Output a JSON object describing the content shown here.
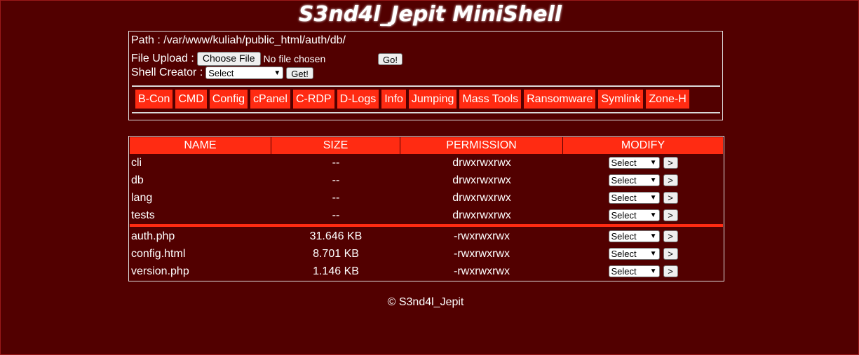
{
  "header": {
    "title": "S3nd4l_Jepit MiniShell"
  },
  "panel": {
    "path_label": "Path :",
    "path_value": "/var/www/kuliah/public_html/auth/db/",
    "upload_label": "File Upload :",
    "choose_file_label": "Choose File",
    "no_file_text": "No file chosen",
    "go_label": "Go!",
    "shell_label": "Shell Creator :",
    "shell_select": "Select",
    "get_label": "Get!",
    "tools": [
      "B-Con",
      "CMD",
      "Config",
      "cPanel",
      "C-RDP",
      "D-Logs",
      "Info",
      "Jumping",
      "Mass Tools",
      "Ransomware",
      "Symlink",
      "Zone-H"
    ]
  },
  "table": {
    "headers": [
      "NAME",
      "SIZE",
      "PERMISSION",
      "MODIFY"
    ],
    "dirs": [
      {
        "name": "cli",
        "size": "--",
        "perm": "drwxrwxrwx",
        "select": "Select",
        "btn": ">"
      },
      {
        "name": "db",
        "size": "--",
        "perm": "drwxrwxrwx",
        "select": "Select",
        "btn": ">"
      },
      {
        "name": "lang",
        "size": "--",
        "perm": "drwxrwxrwx",
        "select": "Select",
        "btn": ">"
      },
      {
        "name": "tests",
        "size": "--",
        "perm": "drwxrwxrwx",
        "select": "Select",
        "btn": ">"
      }
    ],
    "files": [
      {
        "name": "auth.php",
        "size": "31.646 KB",
        "perm": "-rwxrwxrwx",
        "select": "Select",
        "btn": ">"
      },
      {
        "name": "config.html",
        "size": "8.701 KB",
        "perm": "-rwxrwxrwx",
        "select": "Select",
        "btn": ">"
      },
      {
        "name": "version.php",
        "size": "1.146 KB",
        "perm": "-rwxrwxrwx",
        "select": "Select",
        "btn": ">"
      }
    ]
  },
  "footer": {
    "text": "© S3nd4l_Jepit"
  },
  "colors": {
    "background": "#520000",
    "accent": "#ff2b12",
    "text": "#ffffff"
  }
}
